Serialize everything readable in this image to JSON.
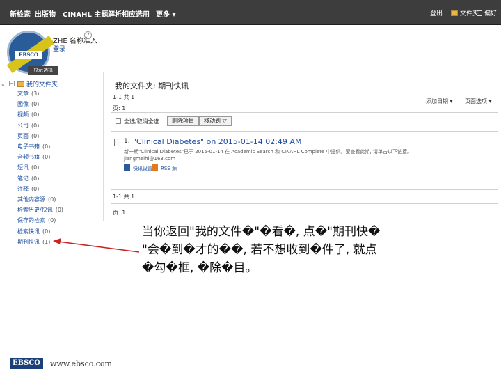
{
  "nav": {
    "items": [
      "新检索",
      "出版物",
      "CINAHL 主题",
      "解析相应选用",
      "更多 ▾"
    ],
    "right": [
      "登出",
      "文件夹",
      "偏好"
    ]
  },
  "header": {
    "site_name": "ZHE 名称准入",
    "login_link": "登录",
    "logo_text": "EBSCO",
    "logo_tab": "显示选择"
  },
  "sidebar": {
    "root_label": "我的文件夹",
    "items": [
      {
        "label": "文章",
        "count": "(3)"
      },
      {
        "label": "图像",
        "count": "(0)"
      },
      {
        "label": "视频",
        "count": "(0)"
      },
      {
        "label": "公司",
        "count": "(0)"
      },
      {
        "label": "页面",
        "count": "(0)"
      },
      {
        "label": "电子书籍",
        "count": "(0)"
      },
      {
        "label": "音频书籍",
        "count": "(0)"
      },
      {
        "label": "短讯",
        "count": "(0)"
      },
      {
        "label": "笔记",
        "count": "(0)"
      },
      {
        "label": "注释",
        "count": "(0)"
      },
      {
        "label": "其他内容源",
        "count": "(0)"
      },
      {
        "label": "检索历史/快讯",
        "count": "(0)"
      },
      {
        "label": "保存的检索",
        "count": "(0)"
      },
      {
        "label": "检索快讯",
        "count": "(0)"
      },
      {
        "label": "期刊快讯",
        "count": "(1)"
      }
    ]
  },
  "main": {
    "folder_title": "我的文件夹: 期刊快讯",
    "results_count_top": "1-1 共 1",
    "page_top": "页: 1",
    "sort_by": "添加日期 ▾",
    "page_options": "页面选项 ▾",
    "select_all": "全选/取消全选",
    "delete_button": "删除项目",
    "move_button": "移动到 ▽",
    "result_number": "1.",
    "result_title": "\"Clinical Diabetes\" on 2015-01-14 02:49 AM",
    "result_desc": "新一期\"Clinical Diabetes\"已于 2015-01-14 在 Academic Search 和 CINAHL Complete 中提供。要查看此期, 请单击以下链接。",
    "result_email": "jiangmeihi@163.com",
    "link_edit": "快讯设置",
    "link_rss": "RSS 源",
    "results_count_bottom": "1-1 共 1",
    "page_bottom": "页: 1"
  },
  "annotation": {
    "line1": "当你返回\"我的文件�\"�看�, 点�\"期刊快�",
    "line2": "\"会�到�才的��, 若不想收到�件了, 就点",
    "line3": "�勾�框, �除�目。"
  },
  "footer": {
    "logo_text": "EBSCO",
    "url": "www.ebsco.com"
  },
  "colors": {
    "nav_bg": "#3d3d3d",
    "link": "#1a4c9e",
    "arrow": "#cc2222"
  }
}
